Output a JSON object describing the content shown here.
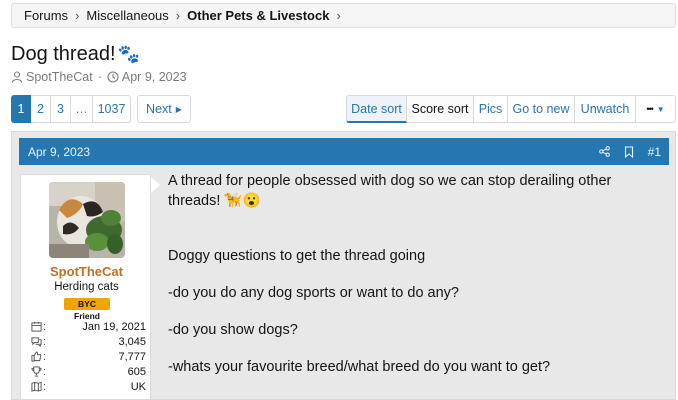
{
  "breadcrumb": {
    "items": [
      "Forums",
      "Miscellaneous",
      "Other Pets & Livestock"
    ]
  },
  "thread": {
    "title": "Dog thread!",
    "title_emoji": "🐾",
    "author": "SpotTheCat",
    "date": "Apr 9, 2023"
  },
  "pager": {
    "pages": [
      "1",
      "2",
      "3",
      "…",
      "1037"
    ],
    "current": "1",
    "next_label": "Next"
  },
  "tools": {
    "items": [
      "Date sort",
      "Score sort",
      "Pics",
      "Go to new",
      "Unwatch"
    ],
    "more_label": "•••"
  },
  "post": {
    "date": "Apr 9, 2023",
    "number": "#1",
    "user": {
      "name": "SpotTheCat",
      "title": "Herding cats",
      "banner": "BYC Friend",
      "stats": {
        "joined": "Jan 19, 2021",
        "messages": "3,045",
        "reaction_score": "7,777",
        "points": "605",
        "location": "UK"
      }
    },
    "lines": [
      "A thread for people obsessed with dog so we can stop derailing other",
      "threads! 🦮😮",
      "Doggy questions to get the thread going",
      "-do you do any dog sports or want to do any?",
      "-do you show dogs?",
      "-whats your favourite breed/what breed do you want to get?"
    ]
  },
  "colors": {
    "accent": "#2577b1",
    "username": "#c46d25",
    "banner": "#f0a500"
  }
}
